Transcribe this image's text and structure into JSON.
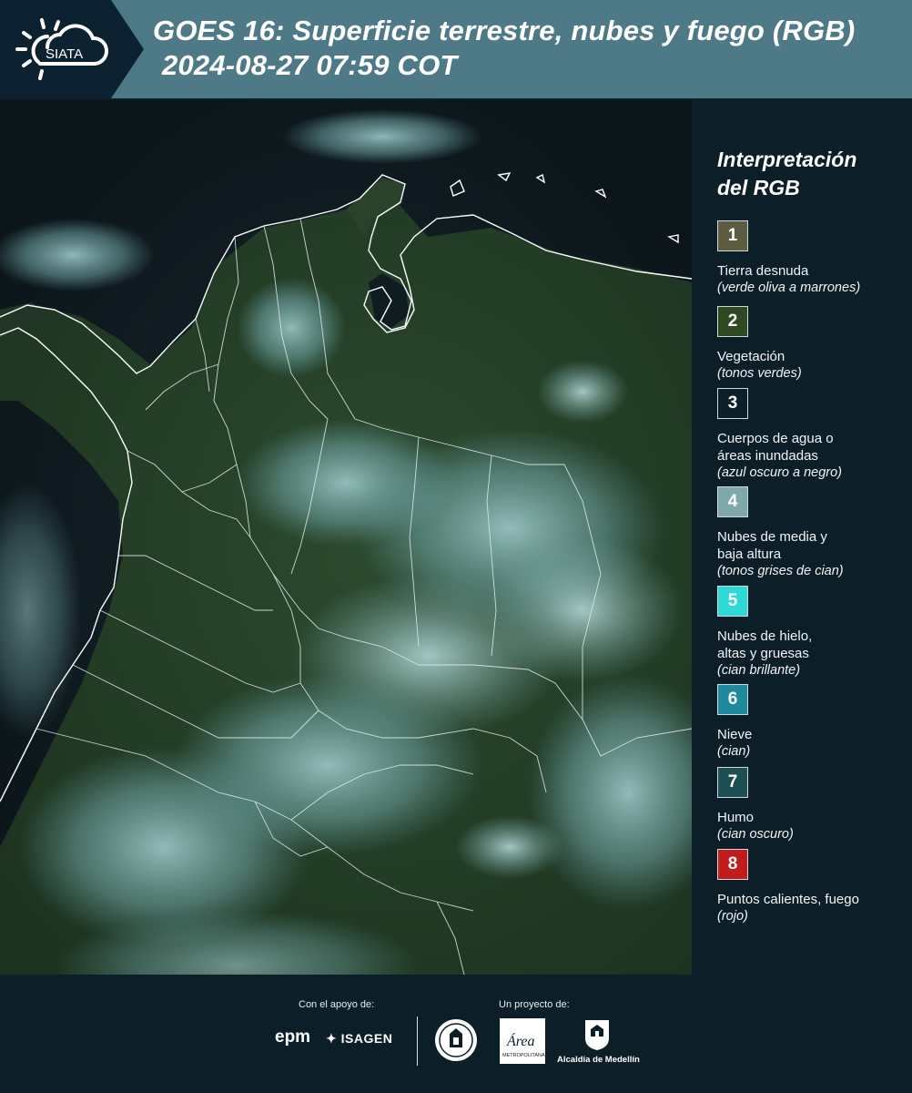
{
  "header": {
    "logo_text": "SIATA",
    "title_line1": "GOES 16: Superficie terrestre, nubes y fuego (RGB)",
    "title_line2": "2024-08-27 07:59 COT"
  },
  "legend": {
    "title": "Interpretación\ndel RGB",
    "items": [
      {
        "number": "1",
        "label": "Tierra desnuda",
        "sub": "(verde oliva a marrones)",
        "color": "#5e5c40"
      },
      {
        "number": "2",
        "label": "Vegetación",
        "sub": "(tonos verdes)",
        "color": "#2f4a22"
      },
      {
        "number": "3",
        "label": "Cuerpos de agua o\náreas inundadas",
        "sub": "(azul oscuro a negro)",
        "color": "#0d1f29"
      },
      {
        "number": "4",
        "label": "Nubes de media y\nbaja altura",
        "sub": "(tonos grises de cian)",
        "color": "#7fa8a8"
      },
      {
        "number": "5",
        "label": "Nubes de hielo,\naltas y gruesas",
        "sub": "(cian brillante)",
        "color": "#2fd9d6"
      },
      {
        "number": "6",
        "label": "Nieve",
        "sub": "(cian)",
        "color": "#1f8a9e"
      },
      {
        "number": "7",
        "label": "Humo",
        "sub": "(cian oscuro)",
        "color": "#1d4f55"
      },
      {
        "number": "8",
        "label": "Puntos calientes, fuego",
        "sub": "(rojo)",
        "color": "#c41c1c"
      }
    ]
  },
  "footer": {
    "support_caption": "Con el apoyo de:",
    "project_caption": "Un proyecto de:",
    "epm": "epm",
    "isagen": "ISAGEN",
    "amva_script": "Área",
    "amva_text": "METROPOLITANA",
    "alcaldia": "Alcaldía de Medellín"
  }
}
